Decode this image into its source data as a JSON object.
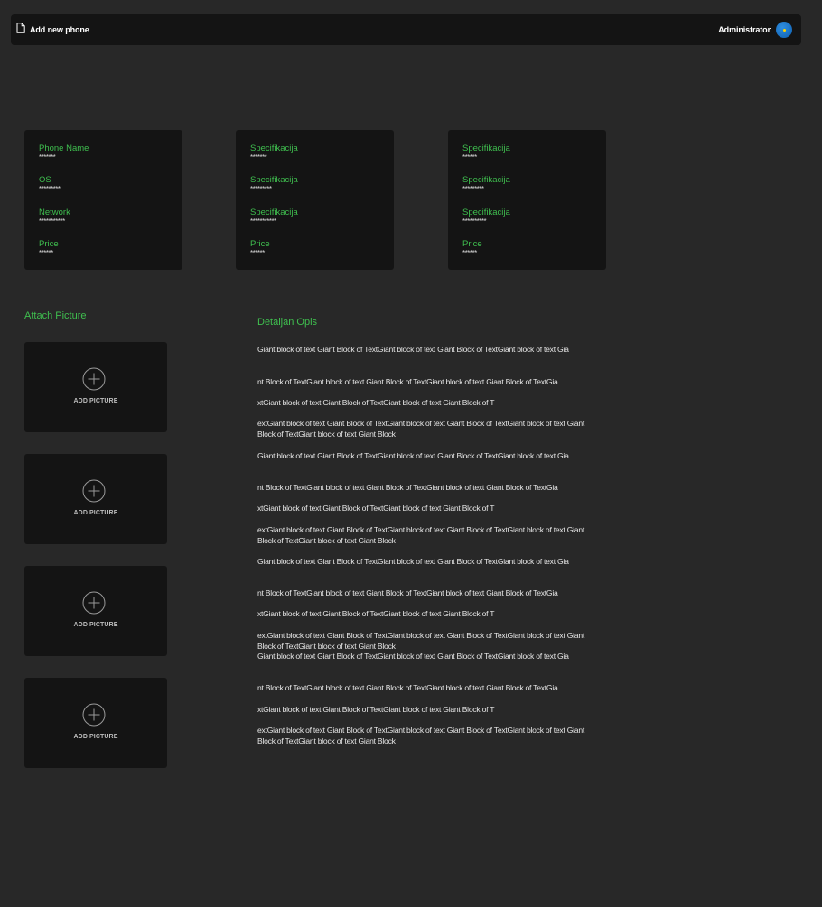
{
  "header": {
    "add_new_phone_label": "Add new phone",
    "user_name": "Administrator"
  },
  "cards": [
    {
      "fields": [
        {
          "label": "Phone Name",
          "value": "*******"
        },
        {
          "label": "OS",
          "value": "*********"
        },
        {
          "label": "Network",
          "value": "***********"
        },
        {
          "label": "Price",
          "value": "******"
        }
      ]
    },
    {
      "fields": [
        {
          "label": "Specifikacija",
          "value": "*******"
        },
        {
          "label": "Specifikacija",
          "value": "*********"
        },
        {
          "label": "Specifikacija",
          "value": "***********"
        },
        {
          "label": "Price",
          "value": "******"
        }
      ]
    },
    {
      "fields": [
        {
          "label": "Specifikacija",
          "value": "******"
        },
        {
          "label": "Specifikacija",
          "value": "*********"
        },
        {
          "label": "Specifikacija",
          "value": "**********"
        },
        {
          "label": "Price",
          "value": "******"
        }
      ]
    }
  ],
  "attach": {
    "title": "Attach Picture",
    "tiles": [
      {
        "label": "ADD PICTURE"
      },
      {
        "label": "ADD PICTURE"
      },
      {
        "label": "ADD PICTURE"
      },
      {
        "label": "ADD PICTURE"
      }
    ]
  },
  "description": {
    "title": "Detaljan Opis",
    "paragraphs": [
      "Giant block of text Giant Block of TextGiant block of text Giant Block of TextGiant block of text Gia",
      "nt Block of TextGiant block of text Giant Block of TextGiant block of text Giant Block of TextGia",
      "xtGiant block of text Giant Block of TextGiant block of text Giant Block of T",
      "extGiant block of text Giant Block of TextGiant block of text Giant Block of TextGiant block of text Giant Block of TextGiant block of text Giant Block",
      "Giant block of text Giant Block of TextGiant block of text Giant Block of TextGiant block of text Gia",
      "nt Block of TextGiant block of text Giant Block of TextGiant block of text Giant Block of TextGia",
      "xtGiant block of text Giant Block of TextGiant block of text Giant Block of T",
      "extGiant block of text Giant Block of TextGiant block of text Giant Block of TextGiant block of text Giant Block of TextGiant block of text Giant Block",
      "Giant block of text Giant Block of TextGiant block of text Giant Block of TextGiant block of text Gia",
      "nt Block of TextGiant block of text Giant Block of TextGiant block of text Giant Block of TextGia",
      "xtGiant block of text Giant Block of TextGiant block of text Giant Block of T",
      "extGiant block of text Giant Block of TextGiant block of text Giant Block of TextGiant block of text Giant Block of TextGiant block of text Giant Block",
      "Giant block of text Giant Block of TextGiant block of text Giant Block of TextGiant block of text Gia",
      "nt Block of TextGiant block of text Giant Block of TextGiant block of text Giant Block of TextGia",
      "xtGiant block of text Giant Block of TextGiant block of text Giant Block of T",
      "extGiant block of text Giant Block of TextGiant block of text Giant Block of TextGiant block of text Giant Block of TextGiant block of text Giant Block"
    ]
  },
  "colors": {
    "background": "#282828",
    "panel": "#141414",
    "accent_green": "#3fbf4f",
    "avatar_blue": "#1a73c8"
  },
  "icons": {
    "add_new_phone": "document-icon",
    "add_picture": "plus-circle-icon",
    "user": "avatar"
  }
}
